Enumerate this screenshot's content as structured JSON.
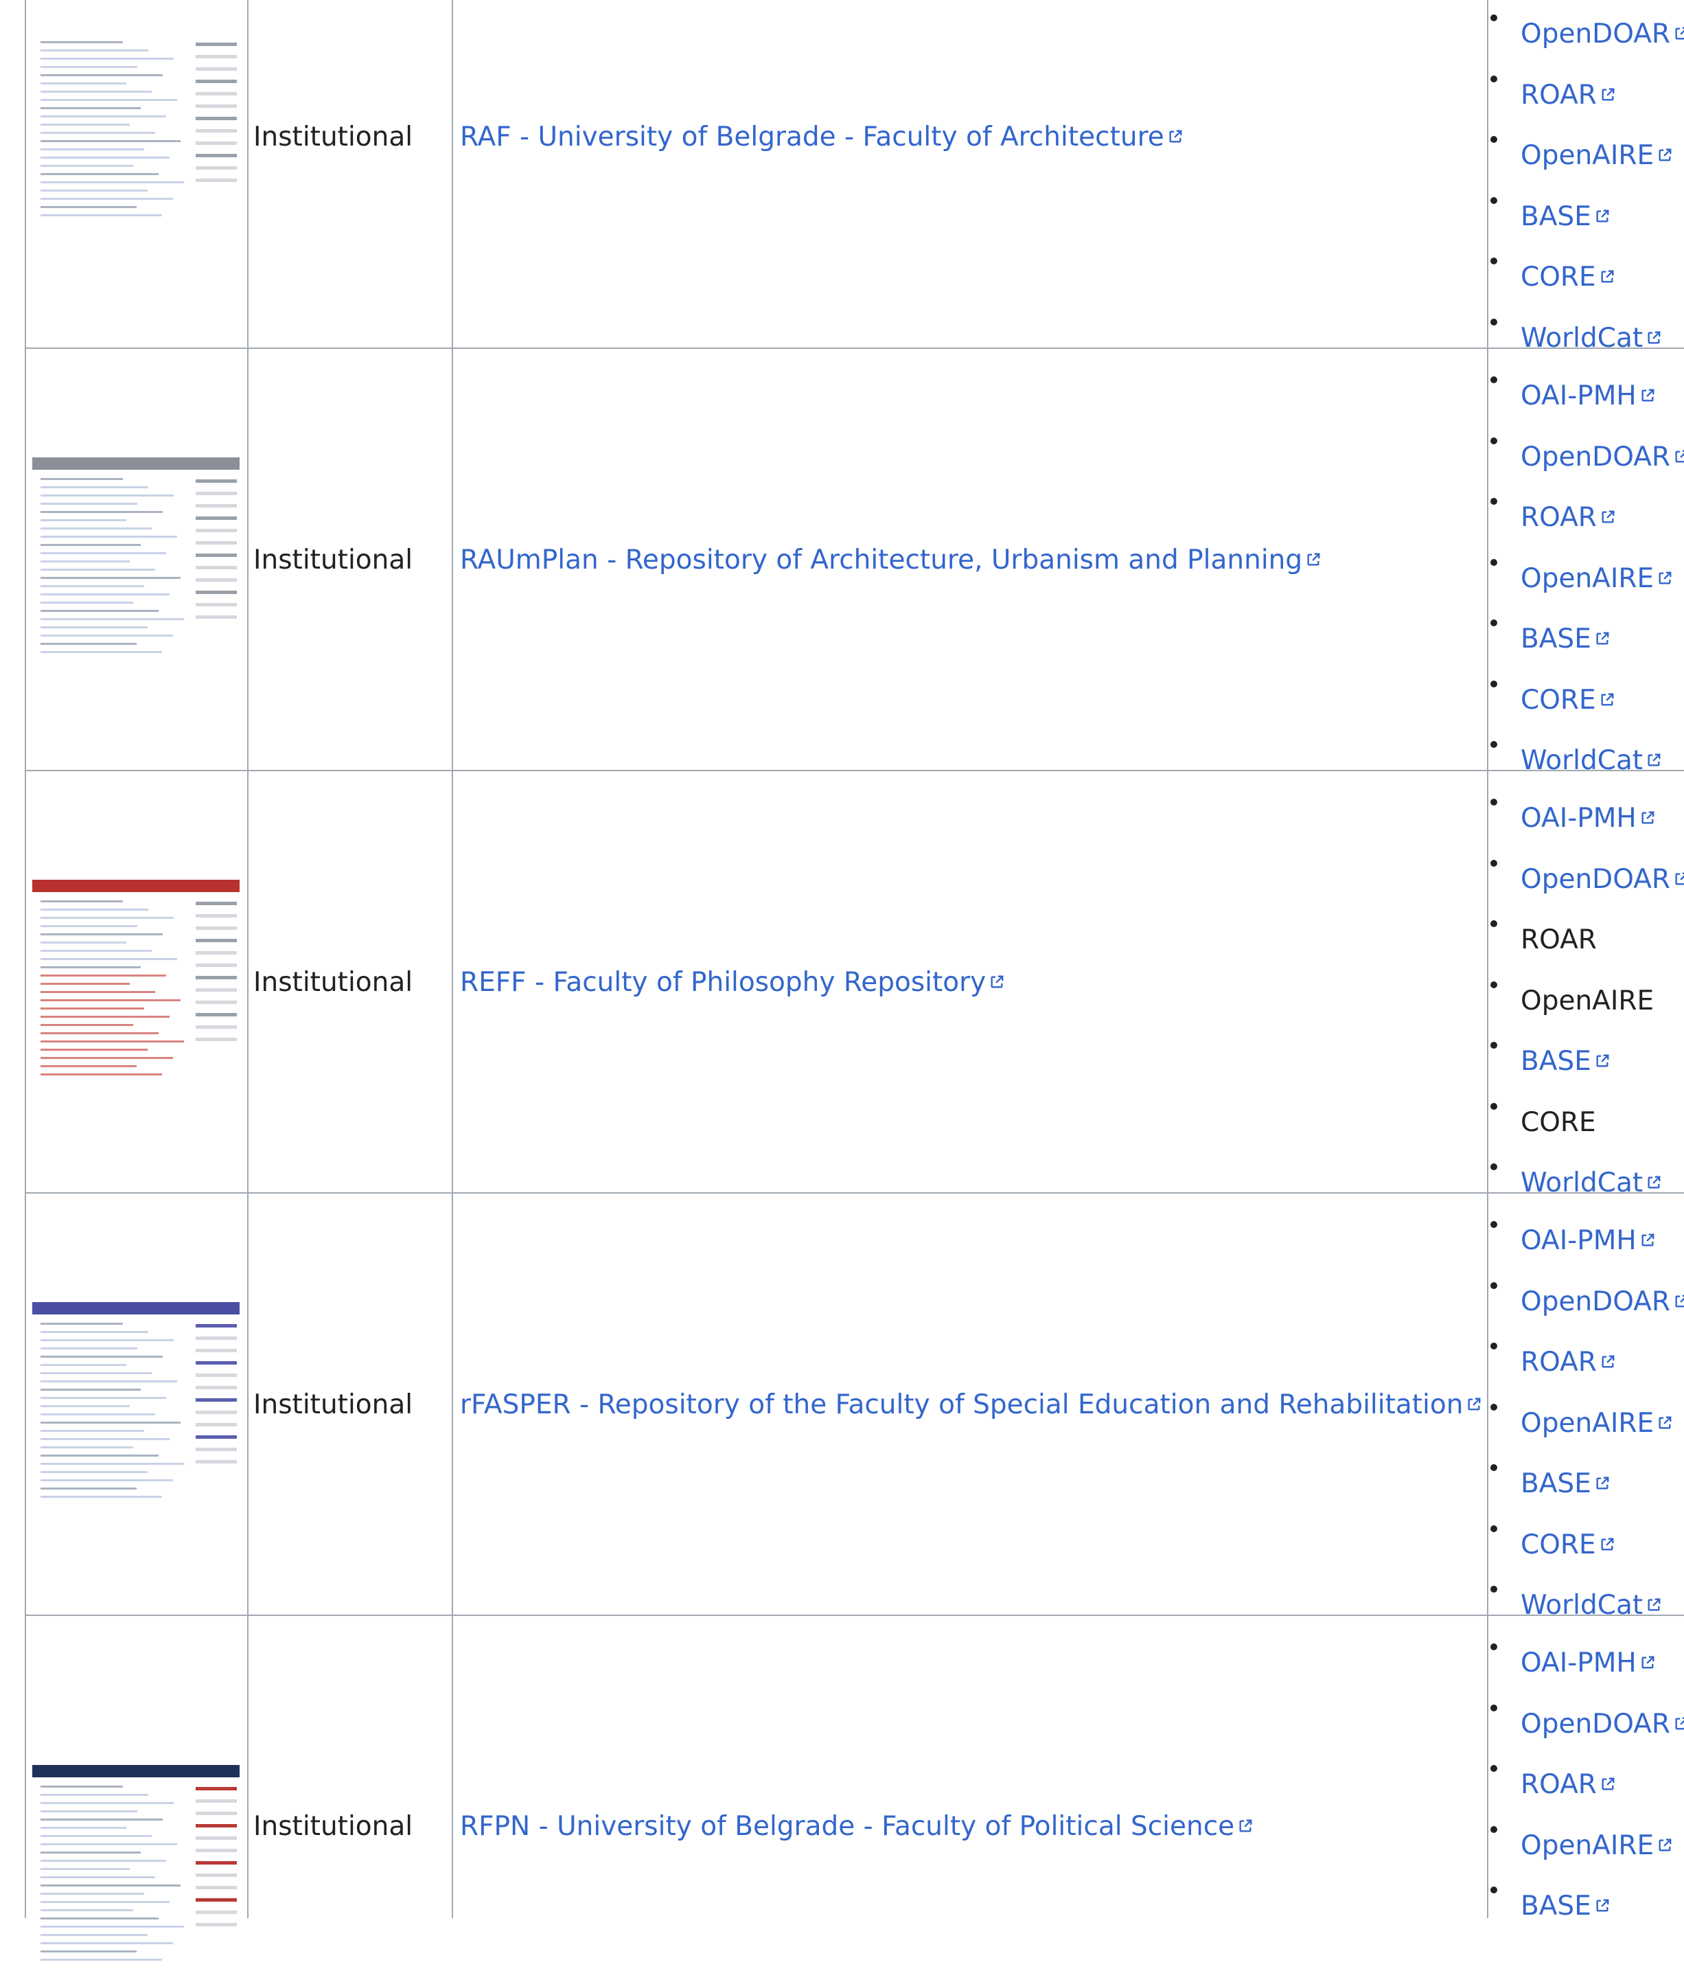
{
  "rows": [
    {
      "type": "Institutional",
      "name": "RAF - University of Belgrade - Faculty of Architecture",
      "thumb_accent": "#ffffff",
      "services": [
        {
          "label": "OpenDOAR",
          "link": true
        },
        {
          "label": "ROAR",
          "link": true
        },
        {
          "label": "OpenAIRE",
          "link": true
        },
        {
          "label": "BASE",
          "link": true
        },
        {
          "label": "CORE",
          "link": true
        },
        {
          "label": "WorldCat",
          "link": true
        }
      ]
    },
    {
      "type": "Institutional",
      "name": "RAUmPlan - Repository of Architecture, Urbanism and Planning",
      "thumb_accent": "#8a8f98",
      "services": [
        {
          "label": "OAI-PMH",
          "link": true
        },
        {
          "label": "OpenDOAR",
          "link": true
        },
        {
          "label": "ROAR",
          "link": true
        },
        {
          "label": "OpenAIRE",
          "link": true
        },
        {
          "label": "BASE",
          "link": true
        },
        {
          "label": "CORE",
          "link": true
        },
        {
          "label": "WorldCat",
          "link": true
        }
      ]
    },
    {
      "type": "Institutional",
      "name": "REFF - Faculty of Philosophy Repository",
      "thumb_accent": "#b8312f",
      "services": [
        {
          "label": "OAI-PMH",
          "link": true
        },
        {
          "label": "OpenDOAR",
          "link": true
        },
        {
          "label": "ROAR",
          "link": false
        },
        {
          "label": "OpenAIRE",
          "link": false
        },
        {
          "label": "BASE",
          "link": true
        },
        {
          "label": "CORE",
          "link": false
        },
        {
          "label": "WorldCat",
          "link": true
        }
      ]
    },
    {
      "type": "Institutional",
      "name": "rFASPER - Repository of the Faculty of Special Education and Rehabilitation",
      "thumb_accent": "#4a4fa3",
      "services": [
        {
          "label": "OAI-PMH",
          "link": true
        },
        {
          "label": "OpenDOAR",
          "link": true
        },
        {
          "label": "ROAR",
          "link": true
        },
        {
          "label": "OpenAIRE",
          "link": true
        },
        {
          "label": "BASE",
          "link": true
        },
        {
          "label": "CORE",
          "link": true
        },
        {
          "label": "WorldCat",
          "link": true
        }
      ]
    },
    {
      "type": "Institutional",
      "name": "RFPN - University of Belgrade - Faculty of Political Science",
      "thumb_accent": "#1f3158",
      "services": [
        {
          "label": "OAI-PMH",
          "link": true
        },
        {
          "label": "OpenDOAR",
          "link": true
        },
        {
          "label": "ROAR",
          "link": true
        },
        {
          "label": "OpenAIRE",
          "link": true
        },
        {
          "label": "BASE",
          "link": true
        }
      ]
    }
  ],
  "icons": {
    "external_link": "external-link-icon"
  },
  "colors": {
    "link": "#3366cc",
    "text": "#202122",
    "border": "#a2a9b1"
  }
}
